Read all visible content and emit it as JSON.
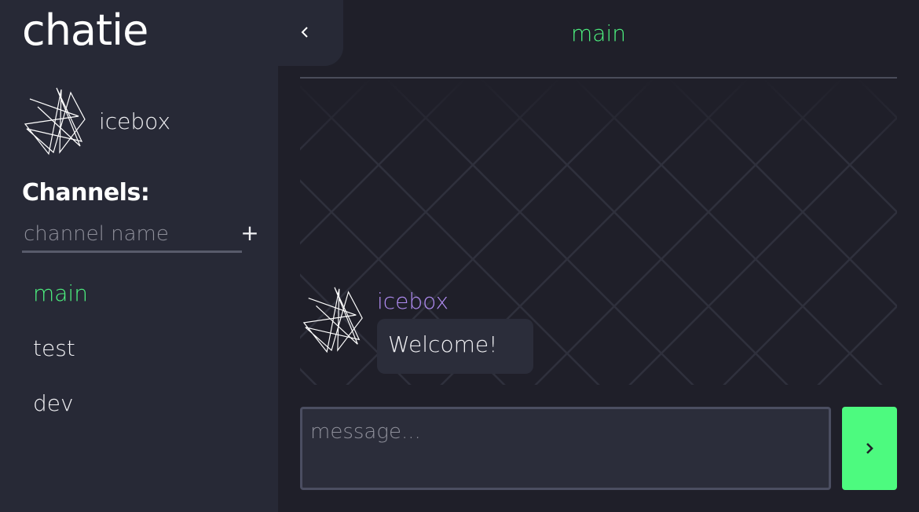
{
  "app": {
    "title": "chatie"
  },
  "sidebar": {
    "collapse_icon": "chevron-left-icon",
    "user": {
      "name": "icebox",
      "avatar_icon": "scribble-avatar-icon"
    },
    "channels_heading": "Channels:",
    "channel_input": {
      "placeholder": "channel name",
      "value": ""
    },
    "add_channel_icon": "plus-icon",
    "channels": [
      {
        "label": "main",
        "active": true
      },
      {
        "label": "test",
        "active": false
      },
      {
        "label": "dev",
        "active": false
      }
    ]
  },
  "header": {
    "channel_title": "main"
  },
  "messages": [
    {
      "author": "icebox",
      "text": "Welcome!",
      "avatar_icon": "scribble-avatar-icon"
    }
  ],
  "composer": {
    "placeholder": "message...",
    "value": "",
    "send_icon": "chevron-right-icon"
  },
  "colors": {
    "accent_green": "#4df27f",
    "author_purple": "#b08cf2",
    "sidebar_bg": "#272936",
    "main_bg": "#1f1f29"
  }
}
